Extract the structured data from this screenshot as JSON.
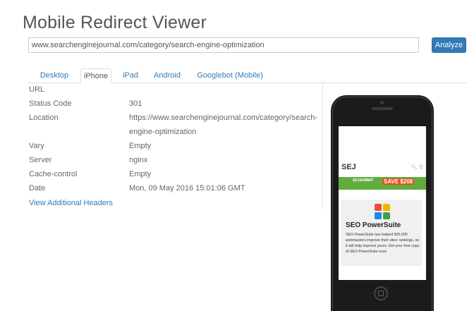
{
  "app": {
    "title": "Mobile Redirect Viewer"
  },
  "search": {
    "value": "www.searchenginejournal.com/category/search-engine-optimization",
    "analyze_label": "Analyze"
  },
  "tabs": [
    {
      "label": "Desktop",
      "active": false
    },
    {
      "label": "iPhone",
      "active": true
    },
    {
      "label": "iPad",
      "active": false
    },
    {
      "label": "Android",
      "active": false
    },
    {
      "label": "Googlebot (Mobile)",
      "active": false
    }
  ],
  "headers": [
    {
      "name": "URL",
      "value": ""
    },
    {
      "name": "Status Code",
      "value": "301"
    },
    {
      "name": "Location",
      "value": "https://www.searchenginejournal.com/category/search-"
    },
    {
      "name": "",
      "value": "engine-optimization"
    },
    {
      "name": "Vary",
      "value": "Empty"
    },
    {
      "name": "Server",
      "value": "nginx"
    },
    {
      "name": "Cache-control",
      "value": "Empty"
    },
    {
      "name": "Date",
      "value": "Mon, 09 May 2016 15:01:06 GMT"
    }
  ],
  "more_link": "View Additional Headers",
  "preview": {
    "logo": "SEJ",
    "banner_text": "SEJSUMMIT",
    "banner_save": "SAVE $208",
    "promo_title": "SEO PowerSuite",
    "promo_text": "SEO PowerSuite has helped 500,000 webmasters improve their sites' rankings, so it will help improve yours. Get your free copy of SEO PowerSuite now!"
  },
  "colors": {
    "link": "#337ab7",
    "button": "#337ab7",
    "phone": "#1b1b1b",
    "banner": "#5fae3d"
  }
}
